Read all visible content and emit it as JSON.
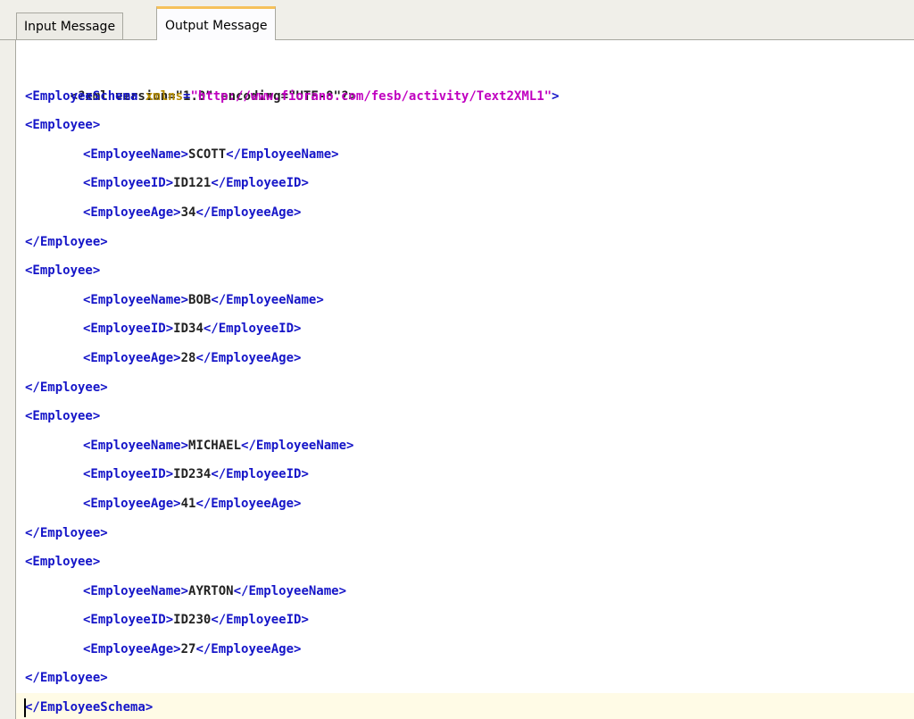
{
  "tabs": [
    {
      "label": "Input Message"
    },
    {
      "label": "Output Message"
    }
  ],
  "xml": {
    "declaration": "<?xml version=\"1.0\" encoding=\"UTF-8\"?>",
    "root_open": "<EmployeeSchema",
    "root_attr": "xmlns",
    "root_eq": "=",
    "root_val": "\"http://www.fiorano.com/fesb/activity/Text2XML1\"",
    "root_close_bracket": ">",
    "employee_open": "<Employee>",
    "employee_close": "</Employee>",
    "name_open": "<EmployeeName>",
    "name_close": "</EmployeeName>",
    "id_open": "<EmployeeID>",
    "id_close": "</EmployeeID>",
    "age_open": "<EmployeeAge>",
    "age_close": "</EmployeeAge>",
    "root_end": "</EmployeeSchema>",
    "employees": [
      {
        "name": "SCOTT",
        "id": "ID121",
        "age": "34"
      },
      {
        "name": "BOB",
        "id": "ID34",
        "age": "28"
      },
      {
        "name": "MICHAEL",
        "id": "ID234",
        "age": "41"
      },
      {
        "name": "AYRTON",
        "id": "ID230",
        "age": "27"
      }
    ]
  }
}
